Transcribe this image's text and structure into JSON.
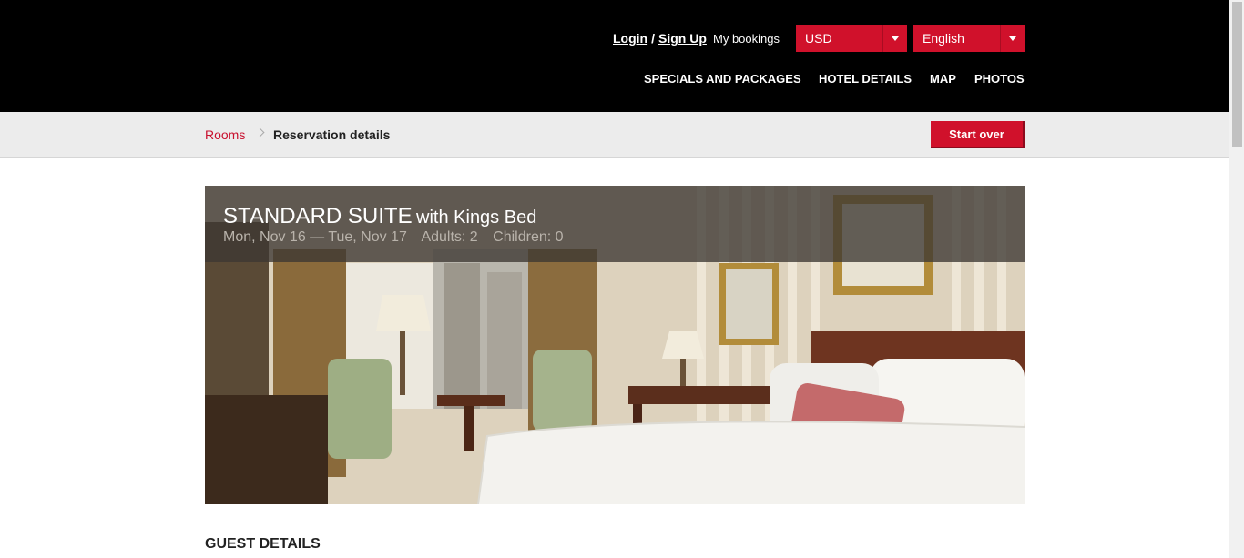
{
  "header": {
    "login": "Login",
    "signup": "Sign Up",
    "separator": "/",
    "my_bookings": "My bookings",
    "currency": "USD",
    "language": "English",
    "nav": [
      "SPECIALS AND PACKAGES",
      "HOTEL DETAILS",
      "MAP",
      "PHOTOS"
    ]
  },
  "breadcrumb": {
    "rooms": "Rooms",
    "current": "Reservation details",
    "start_over": "Start over"
  },
  "room": {
    "name": "STANDARD SUITE",
    "bed": "with Kings Bed",
    "dates": "Mon, Nov 16 — Tue, Nov 17",
    "adults": "Adults: 2",
    "children": "Children: 0"
  },
  "sections": {
    "guest_details": "GUEST DETAILS"
  },
  "colors": {
    "accent": "#d0112b",
    "header_bg": "#000000",
    "crumb_bg": "#ececec"
  }
}
